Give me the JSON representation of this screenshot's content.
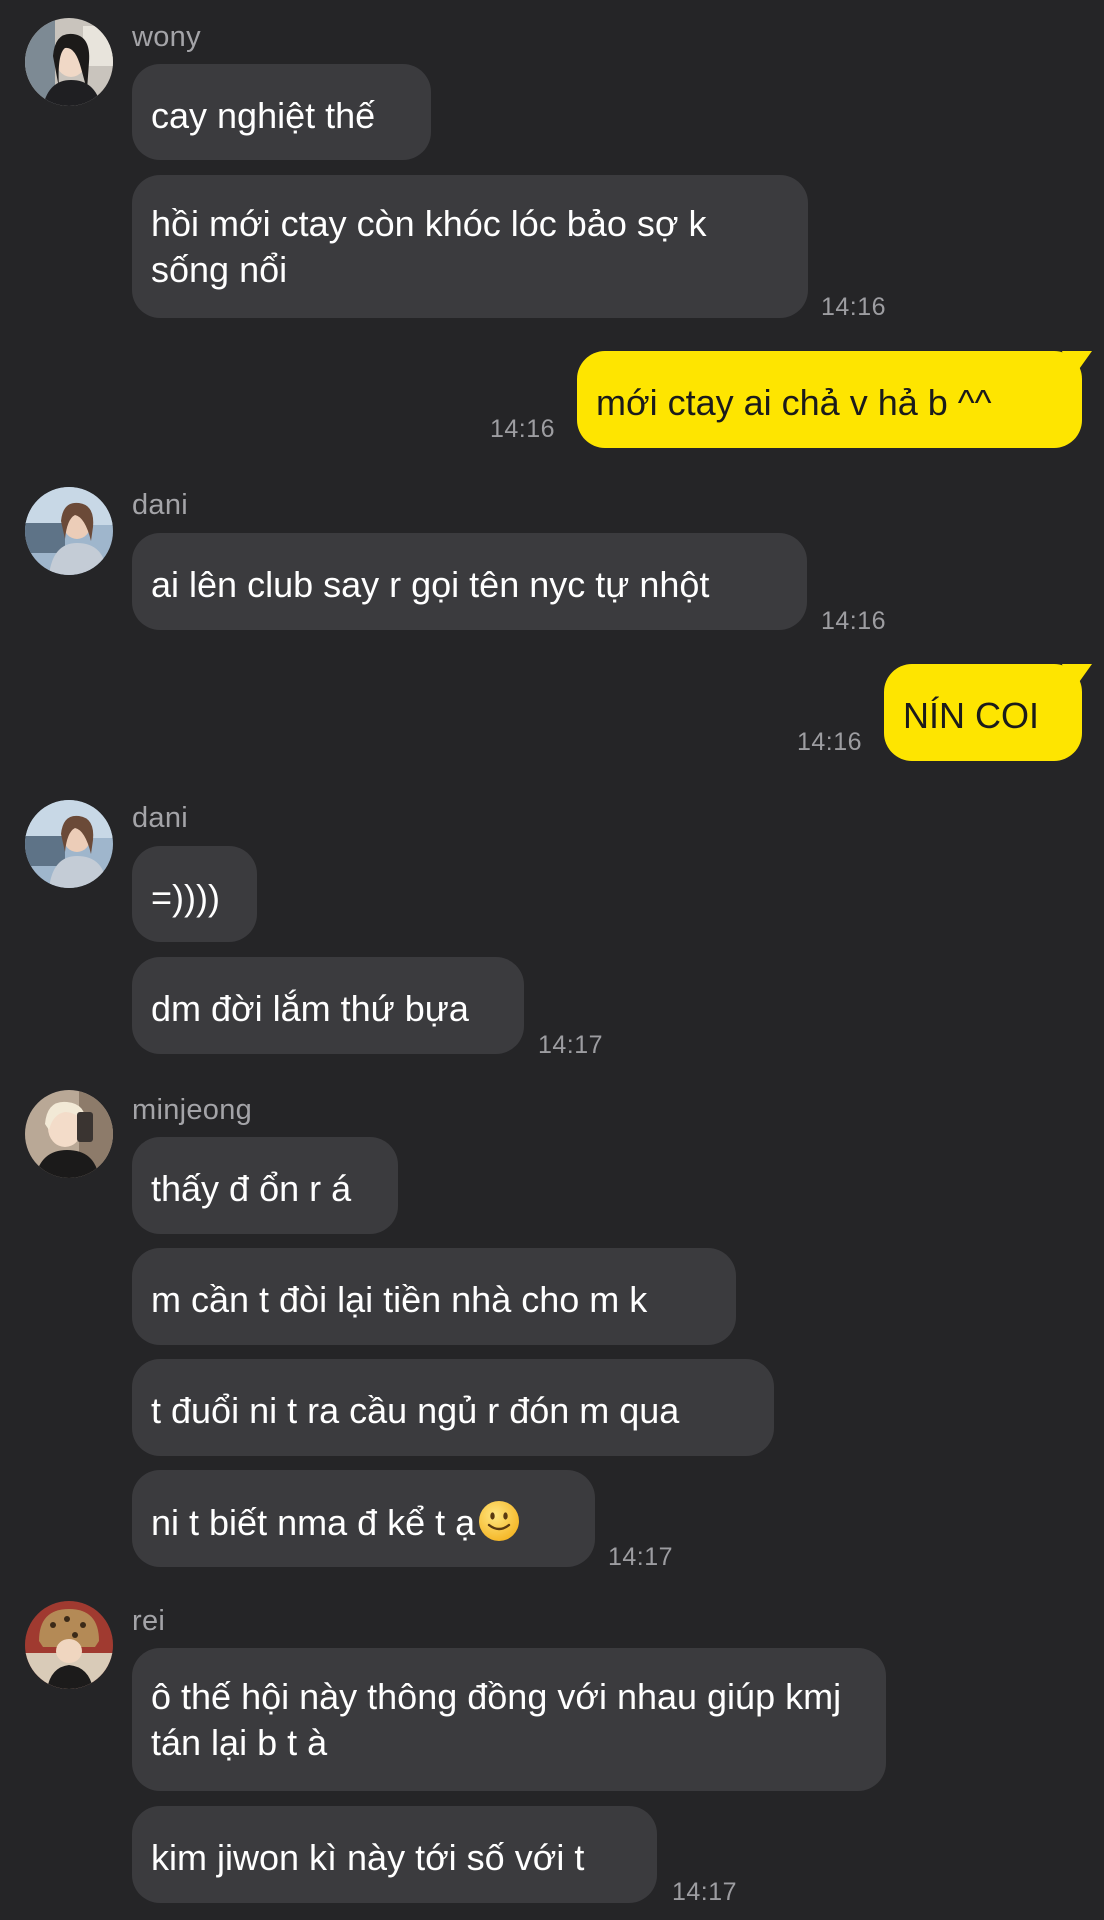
{
  "theme": {
    "background": "#252527",
    "bubble_other": "#3b3b3e",
    "bubble_me": "#fee500",
    "name_color": "#a4a4a8",
    "time_color": "#9d9da1"
  },
  "groups": [
    {
      "sender": "wony",
      "messages": [
        "cay nghiệt thế",
        "hồi mới ctay còn khóc lóc bảo sợ k sống nổi"
      ],
      "time": "14:16"
    },
    {
      "sender": "me",
      "messages": [
        "mới ctay ai chả v hả b ^^"
      ],
      "time": "14:16"
    },
    {
      "sender": "dani",
      "messages": [
        "ai lên club say r gọi tên nyc tự nhột"
      ],
      "time": "14:16"
    },
    {
      "sender": "me",
      "messages": [
        "NÍN COI"
      ],
      "time": "14:16"
    },
    {
      "sender": "dani",
      "messages": [
        "=))))",
        "dm đời lắm thứ bựa"
      ],
      "time": "14:17"
    },
    {
      "sender": "minjeong",
      "messages": [
        "thấy đ ổn r á",
        "m cần t đòi lại tiền nhà cho m k",
        "t đuổi ni t ra cầu ngủ r đón m qua",
        "ni t biết nma đ kể t ạ"
      ],
      "emoji_after_last": "slightly-smiling-face",
      "time": "14:17"
    },
    {
      "sender": "rei",
      "messages": [
        "ô thế hội này thông đồng với nhau giúp kmj tán lại b t à",
        "kim jiwon kì này tới số với t"
      ],
      "time": "14:17"
    }
  ]
}
